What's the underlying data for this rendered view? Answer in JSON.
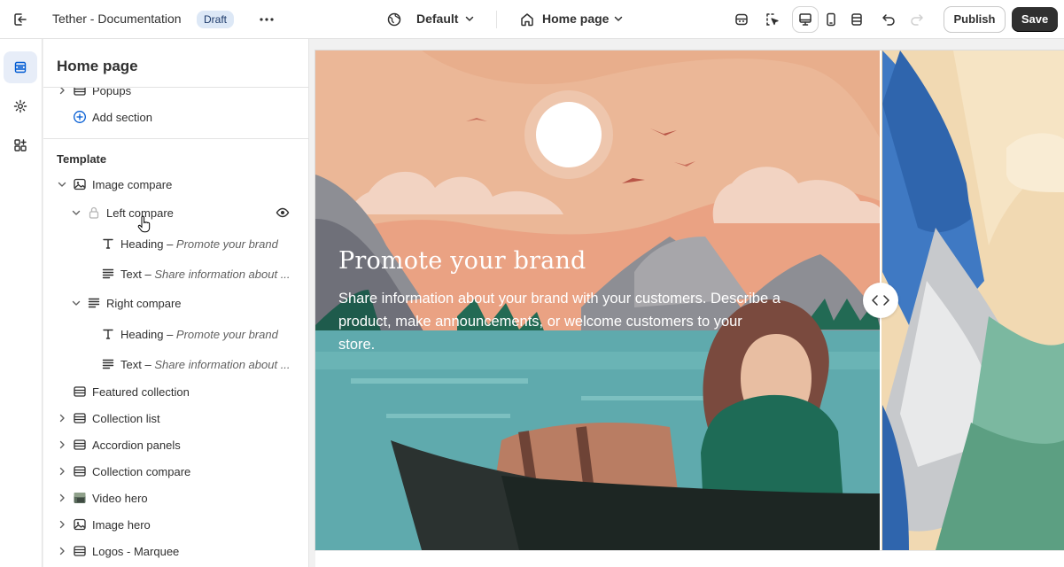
{
  "topbar": {
    "theme_name": "Tether - Documentation",
    "status_badge": "Draft",
    "locale": "Default",
    "page_selector": "Home page",
    "publish_label": "Publish",
    "save_label": "Save"
  },
  "sidebar": {
    "title": "Home page",
    "add_section_label": "Add section",
    "template_label": "Template",
    "rows": {
      "popups": "Popups",
      "image_compare": "Image compare",
      "left_compare": "Left compare",
      "left_heading": "Heading",
      "left_heading_sub": "Promote your brand",
      "left_text": "Text",
      "left_text_sub": "Share information about ...",
      "right_compare": "Right compare",
      "right_heading": "Heading",
      "right_heading_sub": "Promote your brand",
      "right_text": "Text",
      "right_text_sub": "Share information about ...",
      "featured_collection": "Featured collection",
      "collection_list": "Collection list",
      "accordion_panels": "Accordion panels",
      "collection_compare": "Collection compare",
      "video_hero": "Video hero",
      "image_hero": "Image hero",
      "logos_marquee": "Logos - Marquee"
    },
    "dash": "–"
  },
  "preview": {
    "heading": "Promote your brand",
    "body": "Share information about your brand with your customers. Describe a product, make announcements, or welcome customers to your store."
  },
  "icons": {
    "exit": "exit-icon",
    "more": "more-horizontal-icon",
    "globe": "globe-icon",
    "home": "home-icon",
    "chevron": "chevron-down-icon"
  },
  "colors": {
    "accent_blue": "#005bd3",
    "draft_badge_bg": "#dde8f6",
    "save_bg": "#303030",
    "rail_active_bg": "#e7edf8"
  }
}
